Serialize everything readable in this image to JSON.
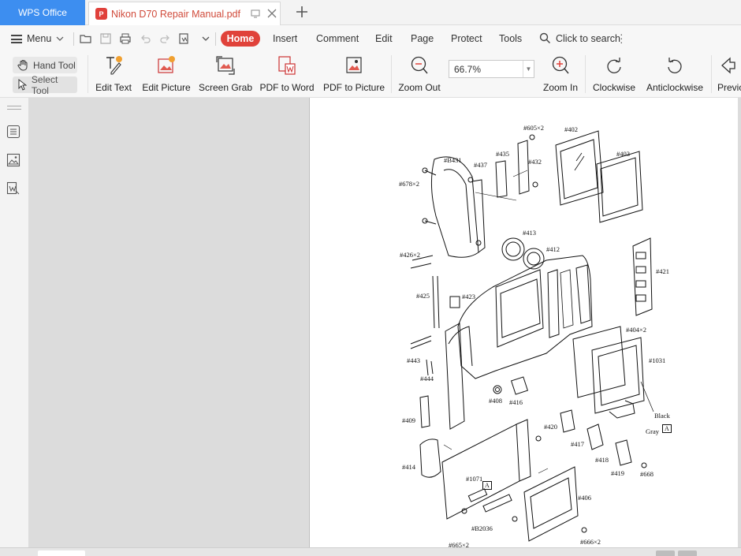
{
  "titlebar": {
    "app_tab": "WPS Office",
    "doc_tab": "Nikon D70 Repair Manual.pdf",
    "pdf_badge": "P"
  },
  "menu": {
    "menu_label": "Menu",
    "tabs": [
      "Home",
      "Insert",
      "Comment",
      "Edit",
      "Page",
      "Protect",
      "Tools"
    ],
    "search_label": "Click to search"
  },
  "ribbon": {
    "hand_tool": "Hand Tool",
    "select_tool": "Select Tool",
    "edit_text": "Edit Text",
    "edit_picture": "Edit Picture",
    "screen_grab": "Screen Grab",
    "pdf_to_word": "PDF to Word",
    "pdf_to_picture": "PDF to Picture",
    "zoom_out": "Zoom Out",
    "zoom_value": "66.7%",
    "zoom_in": "Zoom In",
    "clockwise": "Clockwise",
    "anticlockwise": "Anticlockwise",
    "previous": "Previo"
  },
  "diagram": {
    "labels": {
      "l605": "#605×2",
      "l402": "#402",
      "lb431": "#B431",
      "l435": "#435",
      "l437": "#437",
      "l432": "#432",
      "l403": "#403",
      "l678": "#678×2",
      "l413": "#413",
      "l412": "#412",
      "l426": "#426×2",
      "l421": "#421",
      "l425": "#425",
      "l423": "#423",
      "l404": "#404×2",
      "l1031": "#1031",
      "l443": "#443",
      "l444": "#444",
      "l408": "#408",
      "l416": "#416",
      "l409": "#409",
      "black": "Black",
      "l420": "#420",
      "gray": "Gray",
      "boxa": "A",
      "l417": "#417",
      "l418": "#418",
      "l414": "#414",
      "l419": "#419",
      "l668": "#668",
      "l1071": "#1071",
      "boxa2": "A",
      "l406": "#406",
      "lb2036": "#B2036",
      "l666": "#666×2",
      "l665": "#665×2"
    }
  },
  "colors": {
    "brand_blue": "#3d8ef0",
    "accent_red": "#e0423a",
    "tab_title_red": "#d04a3a"
  }
}
